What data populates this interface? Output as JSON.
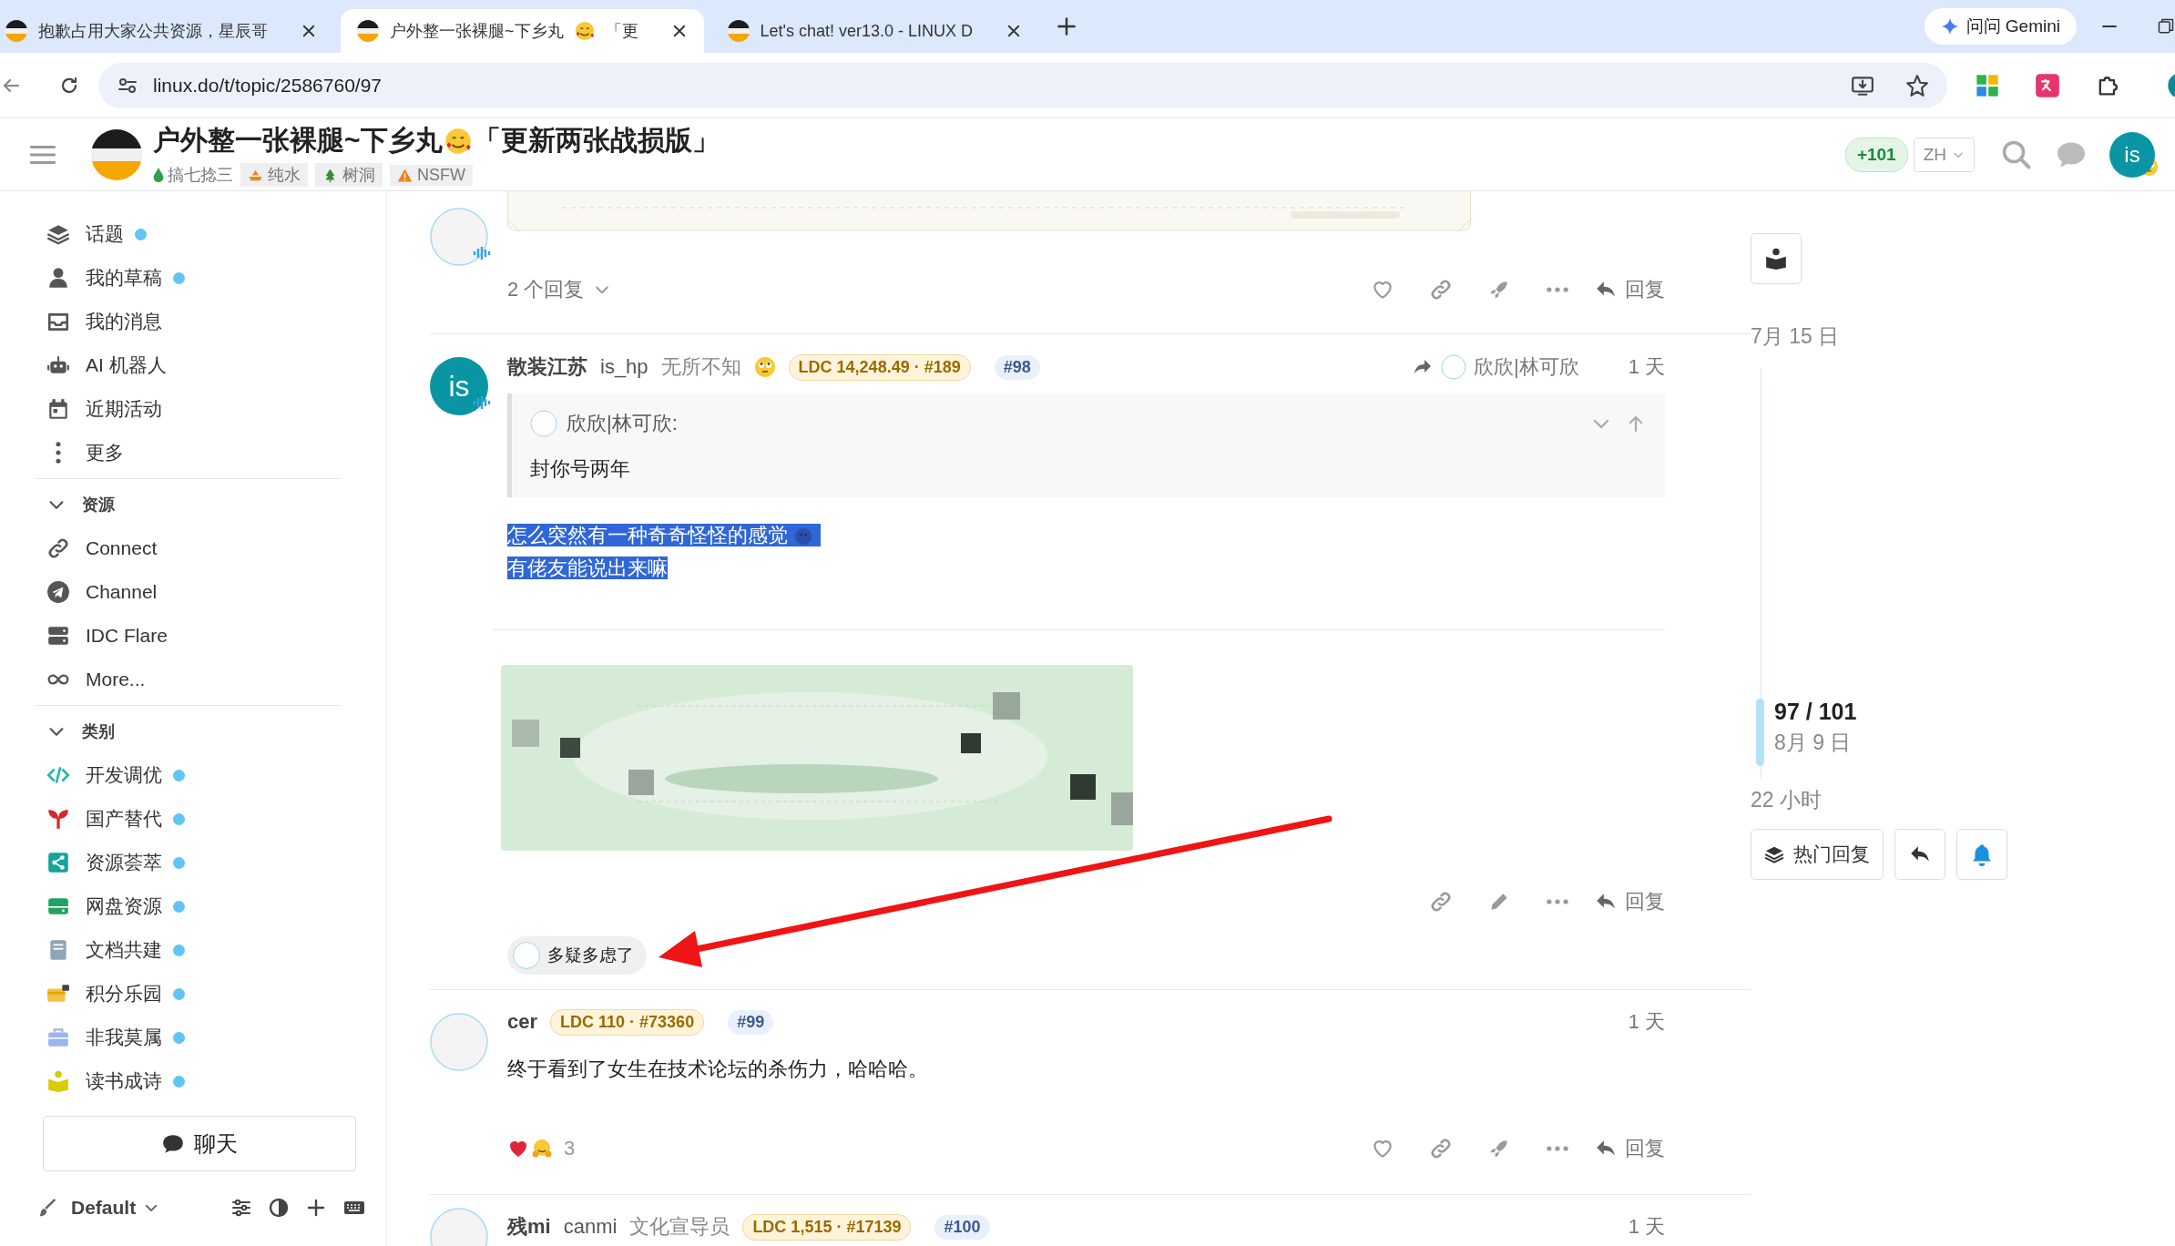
{
  "browser": {
    "tabs": [
      {
        "title": "抱歉占用大家公共资源，星辰哥",
        "selected": false
      },
      {
        "title": "户外整一张裸腿~下乡丸",
        "title_tail": "「更",
        "selected": true
      },
      {
        "title": "Let's chat! ver13.0 - LINUX D",
        "selected": false
      }
    ],
    "address": "linux.do/t/topic/2586760/97",
    "gemini": "问问 Gemini"
  },
  "header": {
    "title": "户外整一张裸腿~下乡丸",
    "title_tail": "「更新两张战损版」",
    "category": "搞七捻三",
    "tags": [
      {
        "label": "纯水"
      },
      {
        "label": "树洞"
      },
      {
        "label": "NSFW"
      }
    ],
    "badge": "+101",
    "language": "ZH",
    "avatar": "is"
  },
  "sidebar": {
    "items": [
      {
        "label": "话题",
        "unread": true
      },
      {
        "label": "我的草稿",
        "unread": true
      },
      {
        "label": "我的消息",
        "unread": false
      },
      {
        "label": "AI 机器人",
        "unread": false
      },
      {
        "label": "近期活动",
        "unread": false
      },
      {
        "label": "更多",
        "unread": false
      }
    ],
    "sections": [
      {
        "title": "资源",
        "expanded": true,
        "links": [
          {
            "label": "Connect",
            "unread": false
          },
          {
            "label": "Channel",
            "unread": false
          },
          {
            "label": "IDC Flare",
            "unread": false
          },
          {
            "label": "More...",
            "unread": false
          }
        ]
      },
      {
        "title": "类别",
        "expanded": true,
        "links": [
          {
            "label": "开发调优",
            "unread": true
          },
          {
            "label": "国产替代",
            "unread": true
          },
          {
            "label": "资源荟萃",
            "unread": true
          },
          {
            "label": "网盘资源",
            "unread": true
          },
          {
            "label": "文档共建",
            "unread": true
          },
          {
            "label": "积分乐园",
            "unread": true
          },
          {
            "label": "非我莫属",
            "unread": true
          },
          {
            "label": "读书成诗",
            "unread": true
          }
        ]
      }
    ],
    "chat_button": "聊天",
    "theme": "Default"
  },
  "posts": [
    {
      "top_picture": {
        "kind": "picture"
      },
      "replies": "2 个回复",
      "own_post": false,
      "reply_label": "回复"
    },
    {
      "avatar": "is",
      "name": "散装江苏",
      "username": "is_hp",
      "user_title": "无所不知",
      "ldc": "LDC 14,248.49 · #189",
      "number": "#98",
      "reply_to": "欣欣|林可欣",
      "time": "1 天",
      "quote": {
        "author": "欣欣|林可欣:",
        "text": "封你号两年"
      },
      "body": [
        "怎么突然有一种奇奇怪怪的感觉",
        "有佬友能说出来嘛"
      ],
      "selected": true,
      "image": {
        "kind": "picture"
      },
      "own_post": true,
      "reply_label": "回复",
      "reply_chip": "多疑多虑了"
    },
    {
      "name": "cer",
      "ldc": "LDC 110 · #73360",
      "number": "#99",
      "time": "1 天",
      "body": [
        "终于看到了女生在技术论坛的杀伤力，哈哈哈。"
      ],
      "selected": false,
      "reaction_count": "3",
      "own_post": false,
      "reply_label": "回复"
    },
    {
      "name": "残mi",
      "username": "canmi",
      "user_title": "文化宣导员",
      "ldc": "LDC 1,515 · #17139",
      "number": "#100",
      "time": "1 天"
    }
  ],
  "timeline": {
    "start_date": "7月 15 日",
    "position": "97 / 101",
    "position_date": "8月 9 日",
    "end_label": "22 小时",
    "hot_button": "热门回复"
  }
}
